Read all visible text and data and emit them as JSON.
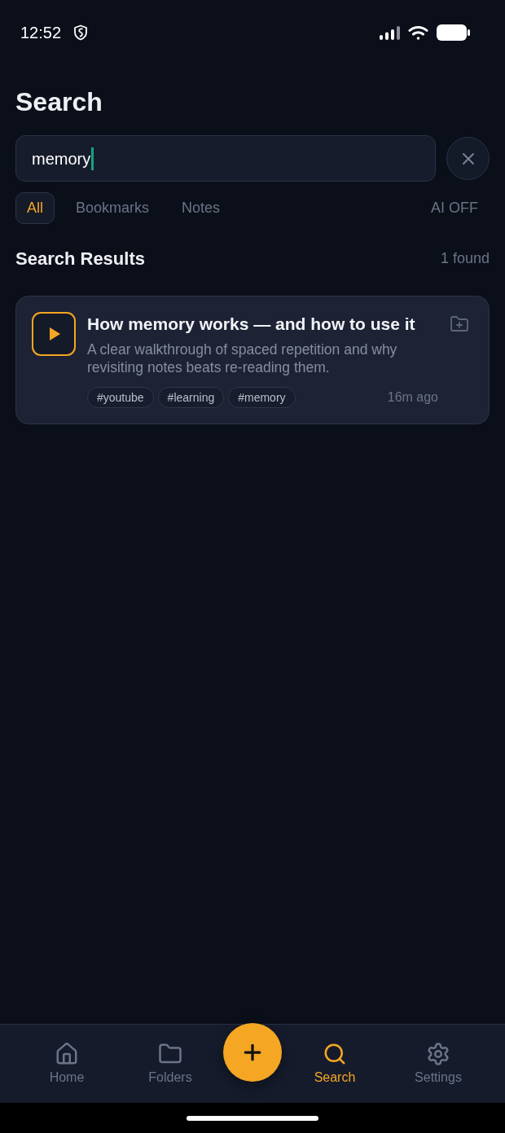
{
  "status_bar": {
    "time": "12:52"
  },
  "header": {
    "title": "Search"
  },
  "search": {
    "value": "memory",
    "focused": true
  },
  "filters": [
    {
      "label": "All",
      "selected": true
    },
    {
      "label": "Bookmarks",
      "selected": false
    },
    {
      "label": "Notes",
      "selected": false
    }
  ],
  "ai_toggle": {
    "label": "AI OFF",
    "on": false
  },
  "results": {
    "title": "Search Results",
    "count": "1 found",
    "items": [
      {
        "kind": "video",
        "title": "How memory works — and how to use it",
        "description": "A clear walkthrough of spaced repetition and why revisiting notes beats re-reading them.",
        "tags": [
          "#youtube",
          "#learning",
          "#memory"
        ],
        "time": "16m ago"
      }
    ]
  },
  "bottom_nav": {
    "items": [
      {
        "label": "Home",
        "selected": false
      },
      {
        "label": "Folders",
        "selected": false
      },
      {
        "label": "Search",
        "selected": true
      },
      {
        "label": "Settings",
        "selected": false
      }
    ]
  }
}
